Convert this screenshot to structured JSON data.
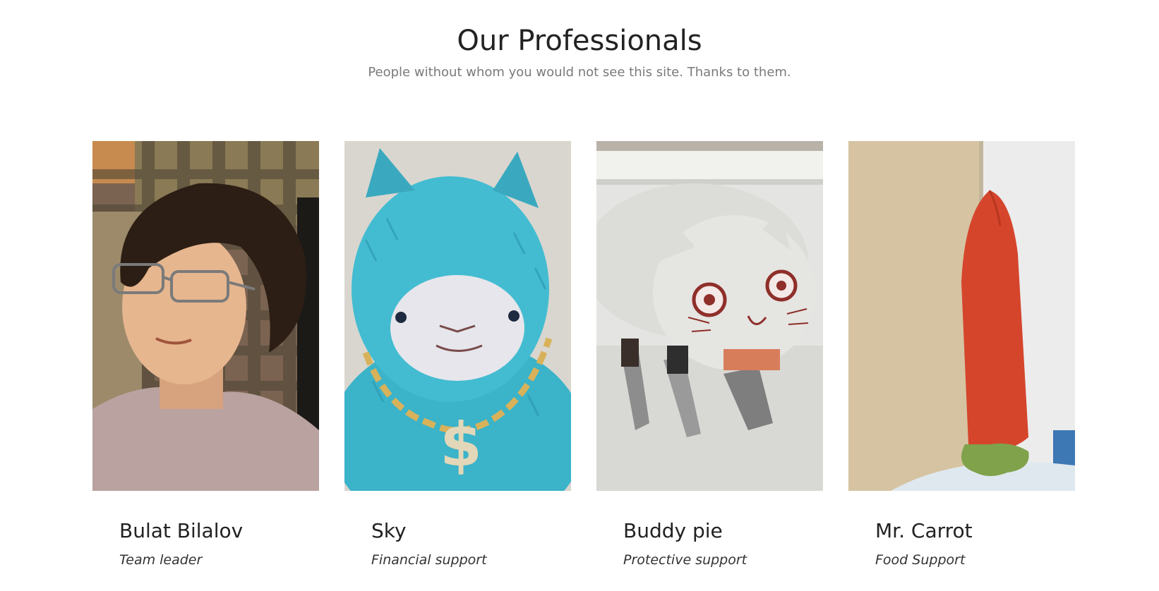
{
  "header": {
    "title": "Our Professionals",
    "subtitle": "People without whom you would not see this site. Thanks to them."
  },
  "team": [
    {
      "name": "Bulat Bilalov",
      "role": "Team leader",
      "photo_icon": "person-photo"
    },
    {
      "name": "Sky",
      "role": "Financial support",
      "photo_icon": "blue-llama-plush-photo"
    },
    {
      "name": "Buddy pie",
      "role": "Protective support",
      "photo_icon": "white-cat-plush-photo"
    },
    {
      "name": "Mr. Carrot",
      "role": "Food Support",
      "photo_icon": "carrot-plush-photo"
    }
  ]
}
